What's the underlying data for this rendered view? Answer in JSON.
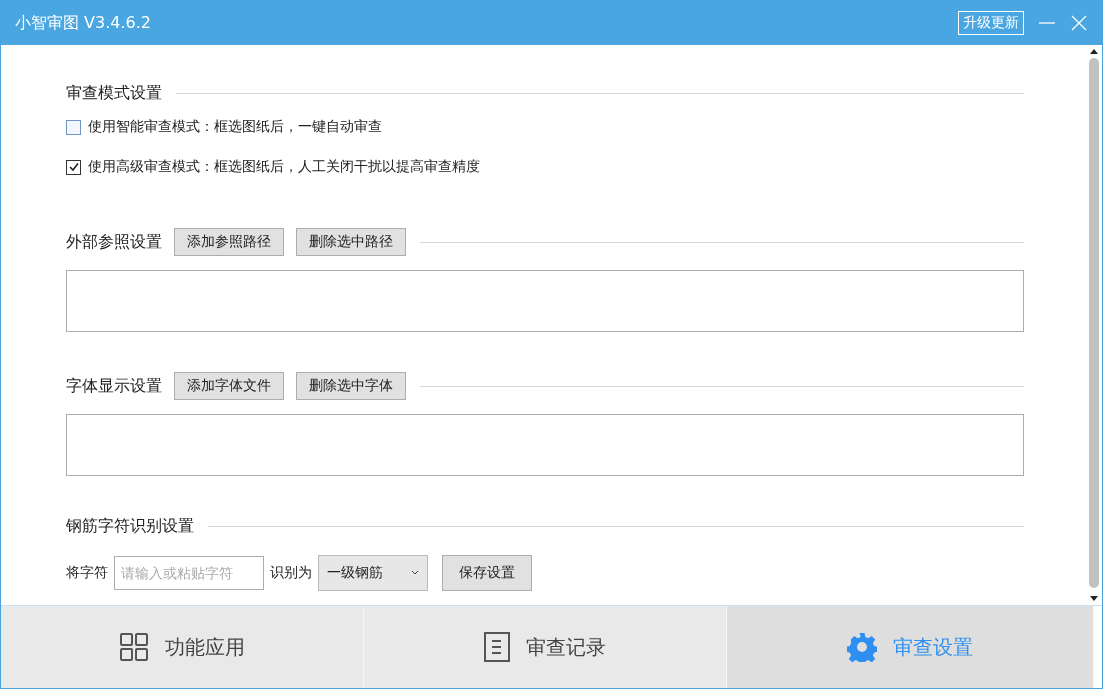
{
  "window": {
    "title": "小智审图 V3.4.6.2",
    "upgrade_button": "升级更新"
  },
  "sections": [
    {
      "kind": "checkboxes",
      "title": "审查模式设置",
      "options": [
        {
          "label": "使用智能审查模式：框选图纸后，一键自动审查",
          "checked": false
        },
        {
          "label": "使用高级审查模式：框选图纸后，人工关闭干扰以提高审查精度",
          "checked": true
        }
      ]
    },
    {
      "kind": "list",
      "title": "外部参照设置",
      "buttons": [
        "添加参照路径",
        "删除选中路径"
      ]
    },
    {
      "kind": "list",
      "title": "字体显示设置",
      "buttons": [
        "添加字体文件",
        "删除选中字体"
      ]
    },
    {
      "kind": "mapping",
      "title": "钢筋字符识别设置",
      "prefix_label": "将字符",
      "input_placeholder": "请输入或粘贴字符",
      "mid_label": "识别为",
      "select_value": "一级钢筋",
      "button": "保存设置"
    }
  ],
  "bottom_tabs": [
    {
      "kind": "grid",
      "label": "功能应用",
      "selected": false
    },
    {
      "kind": "document",
      "label": "审查记录",
      "selected": false
    },
    {
      "kind": "gear",
      "label": "审查设置",
      "selected": true
    }
  ]
}
